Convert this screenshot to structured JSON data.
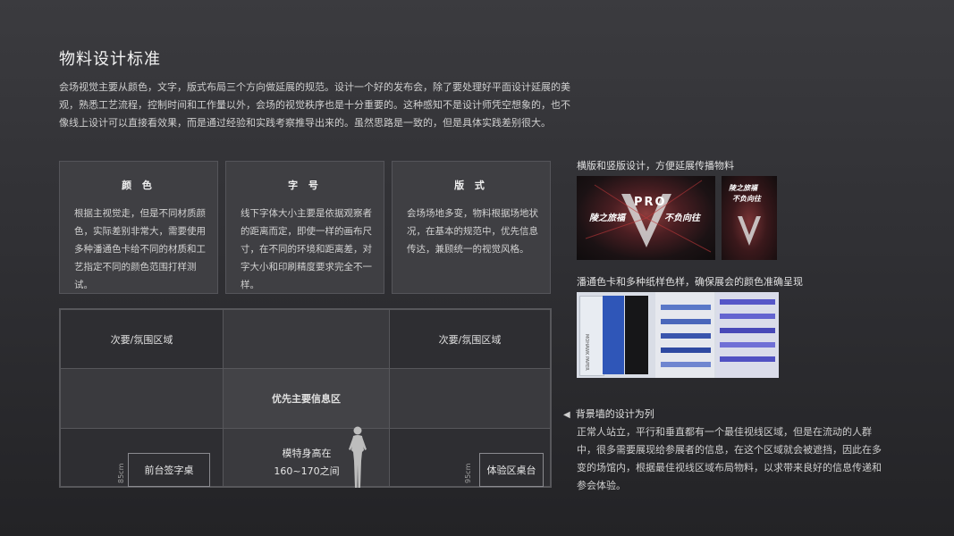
{
  "title": "物料设计标准",
  "intro": "会场视觉主要从颜色，文字，版式布局三个方向做延展的规范。设计一个好的发布会，除了要处理好平面设计延展的美观，熟悉工艺流程，控制时间和工作量以外，会场的视觉秩序也是十分重要的。这种感知不是设计师凭空想象的，也不像线上设计可以直接看效果，而是通过经验和实践考察推导出来的。虽然思路是一致的，但是具体实践差别很大。",
  "cards": [
    {
      "title": "颜 色",
      "body": "根据主视觉走，但是不同材质颜色，实际差别非常大，需要使用多种潘通色卡给不同的材质和工艺指定不同的颜色范围打样测试。"
    },
    {
      "title": "字 号",
      "body": "线下字体大小主要是依据观察者的距离而定，即使一样的画布尺寸，在不同的环境和距离差，对字大小和印刷精度要求完全不一样。"
    },
    {
      "title": "版 式",
      "body": "会场场地多变，物料根据场地状况，在基本的规范中，优先信息传达，兼顾统一的视觉风格。"
    }
  ],
  "grid": {
    "secondary_left": "次要/氛围区域",
    "secondary_right": "次要/氛围区域",
    "primary": "优先主要信息区",
    "model_line1": "模特身高在",
    "model_line2": "160~170之间",
    "desk_left_height": "85cm",
    "desk_left_label": "前台签字桌",
    "desk_right_height": "95cm",
    "desk_right_label": "体验区桌台"
  },
  "right": {
    "caption_layout": "横版和竖版设计，方便延展传播物料",
    "poster_text1": "陵之旅福",
    "poster_text2": "不负向往",
    "poster_mark": "PRO",
    "caption_pantone": "潘通色卡和多种纸样色样，确保展会的颜色准确呈现",
    "swatch_brand": "MOHAWK PAPER",
    "note_title": "背景墙的设计为列",
    "note_arrow": "◀",
    "note_body": "正常人站立，平行和垂直都有一个最佳视线区域，但是在流动的人群中，很多需要展现给参展者的信息，在这个区域就会被遮挡，因此在多变的场馆内，根据最佳视线区域布局物料，以求带来良好的信息传递和参会体验。"
  },
  "colors": {
    "poster_red": "#c0393b",
    "pantone_blue": "#2f56b8",
    "pantone_violet": "#5656c8"
  }
}
